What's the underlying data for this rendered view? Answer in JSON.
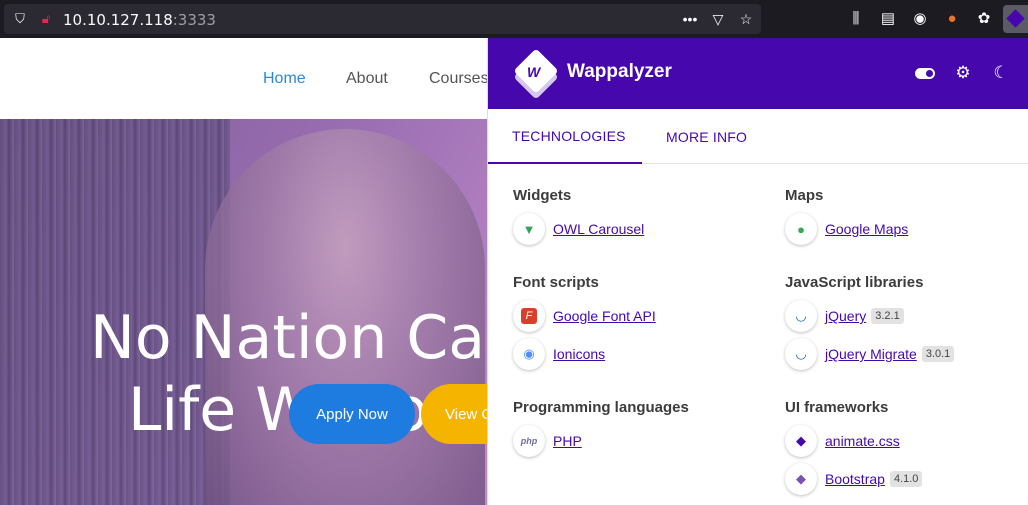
{
  "browser": {
    "url_host": "10.10.127.118",
    "url_port": ":3333",
    "icons": [
      "shield-icon",
      "insecure-lock-icon",
      "more-icon",
      "pocket-icon",
      "bookmark-star-icon",
      "library-icon",
      "reader-icon",
      "account-icon",
      "extension-icon",
      "cookie-icon",
      "wappalyzer-icon"
    ]
  },
  "site": {
    "nav": [
      "Home",
      "About",
      "Courses"
    ],
    "hero_line1": "No Nation Can",
    "hero_line2": "Life Without E",
    "apply_label": "Apply Now",
    "view_label": "View C"
  },
  "wappalyzer": {
    "brand": "Wappalyzer",
    "tabs": [
      "TECHNOLOGIES",
      "MORE INFO"
    ],
    "categories": [
      {
        "name": "Widgets",
        "items": [
          {
            "name": "OWL Carousel",
            "version": "",
            "icon": "owl-icon"
          }
        ]
      },
      {
        "name": "Maps",
        "items": [
          {
            "name": "Google Maps",
            "version": "",
            "icon": "map-pin-icon"
          }
        ]
      },
      {
        "name": "Font scripts",
        "items": [
          {
            "name": "Google Font API",
            "version": "",
            "icon": "font-icon"
          },
          {
            "name": "Ionicons",
            "version": "",
            "icon": "ionicons-icon"
          }
        ]
      },
      {
        "name": "JavaScript libraries",
        "items": [
          {
            "name": "jQuery",
            "version": "3.2.1",
            "icon": "jquery-icon"
          },
          {
            "name": "jQuery Migrate",
            "version": "3.0.1",
            "icon": "jquery-icon"
          }
        ]
      },
      {
        "name": "Programming languages",
        "items": [
          {
            "name": "PHP",
            "version": "",
            "icon": "php-icon"
          }
        ]
      },
      {
        "name": "UI frameworks",
        "items": [
          {
            "name": "animate.css",
            "version": "",
            "icon": "animate-icon"
          },
          {
            "name": "Bootstrap",
            "version": "4.1.0",
            "icon": "bootstrap-icon"
          }
        ]
      }
    ],
    "colors": {
      "accent": "#4608ad",
      "header": "#4608ad",
      "link": "#4608ad"
    }
  }
}
